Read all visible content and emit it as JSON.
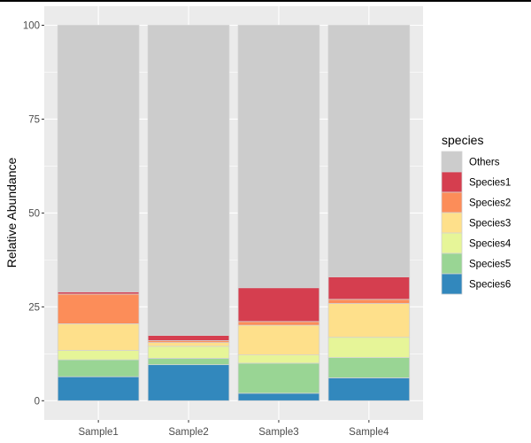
{
  "chart_data": {
    "type": "bar",
    "stacked": true,
    "title": "",
    "xlabel": "",
    "ylabel": "Relative Abundance",
    "ylim": [
      0,
      100
    ],
    "yticks": [
      0,
      25,
      50,
      75,
      100
    ],
    "grid": true,
    "categories": [
      "Sample1",
      "Sample2",
      "Sample3",
      "Sample4"
    ],
    "legend": {
      "title": "species",
      "position": "right"
    },
    "series": [
      {
        "name": "Others",
        "color": "#cccccc",
        "values": [
          71.0,
          82.6,
          69.9,
          67.0
        ]
      },
      {
        "name": "Species1",
        "color": "#d53e4f",
        "values": [
          0.6,
          1.4,
          9.0,
          6.0
        ]
      },
      {
        "name": "Species2",
        "color": "#fc8d59",
        "values": [
          7.9,
          0.5,
          1.0,
          1.1
        ]
      },
      {
        "name": "Species3",
        "color": "#fee08b",
        "values": [
          7.1,
          1.0,
          7.9,
          9.0
        ]
      },
      {
        "name": "Species4",
        "color": "#e6f598",
        "values": [
          2.5,
          3.2,
          2.2,
          5.4
        ]
      },
      {
        "name": "Species5",
        "color": "#99d594",
        "values": [
          4.5,
          1.7,
          8.0,
          5.4
        ]
      },
      {
        "name": "Species6",
        "color": "#3288bd",
        "values": [
          6.4,
          9.6,
          2.0,
          6.1
        ]
      }
    ]
  }
}
